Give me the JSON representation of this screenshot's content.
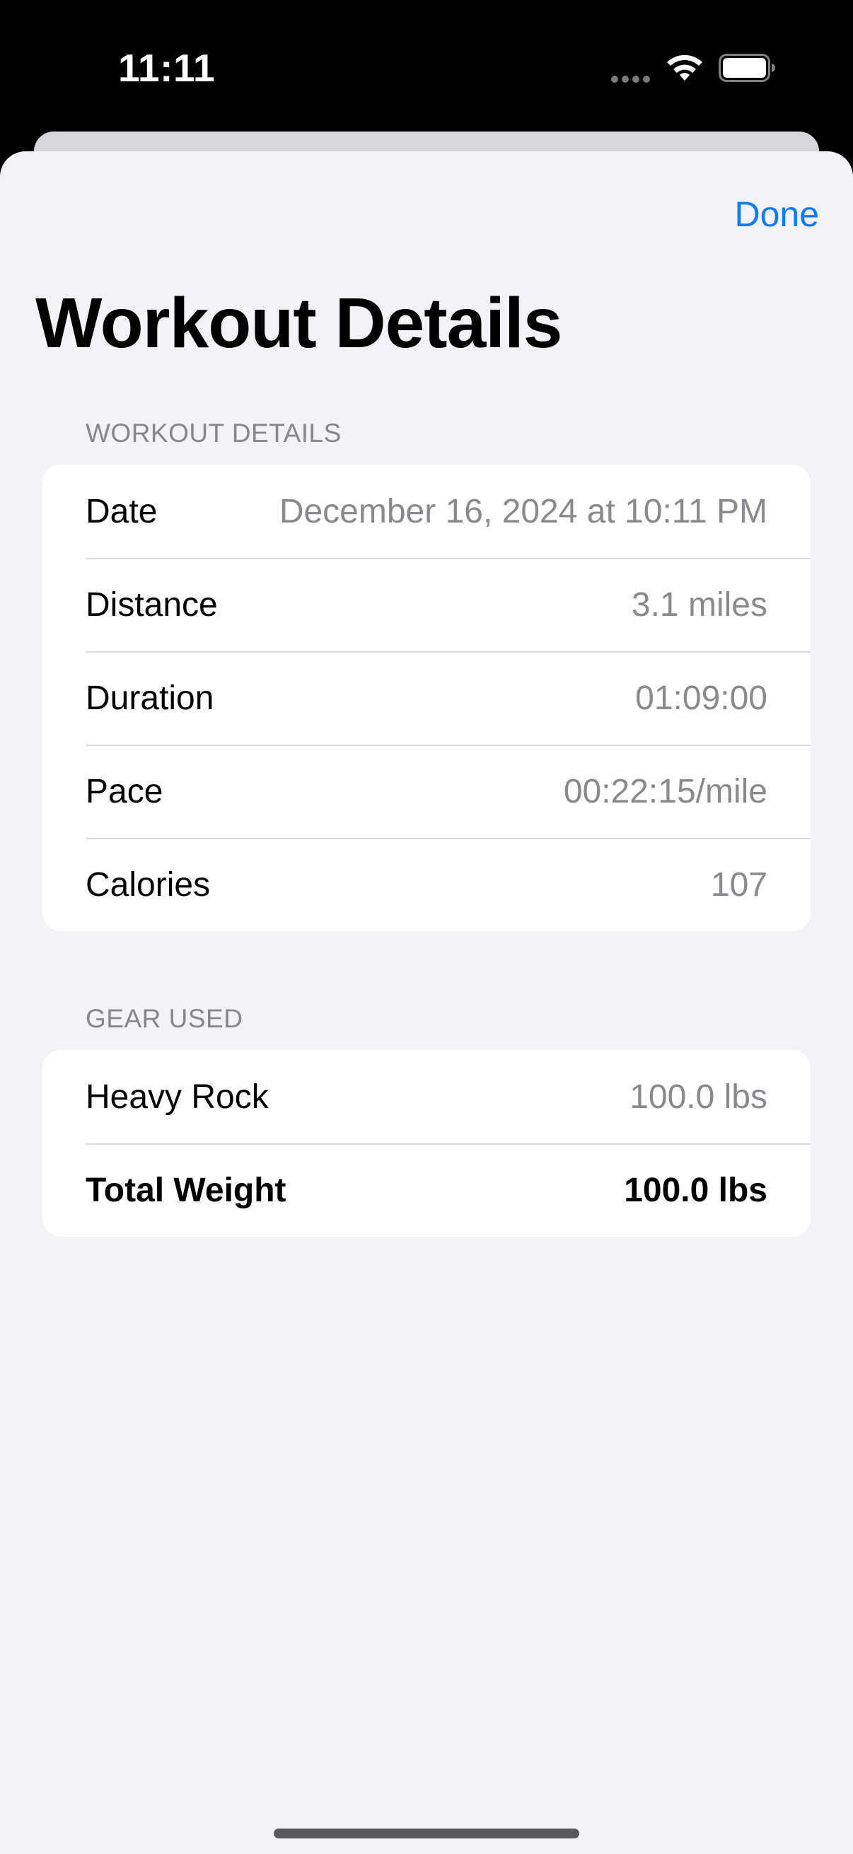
{
  "status_bar": {
    "time": "11:11",
    "wifi_icon": "wifi-icon",
    "battery_icon": "battery-icon"
  },
  "nav": {
    "done_label": "Done",
    "accent_color": "#0a7aff"
  },
  "title": "Workout Details",
  "sections": {
    "workout": {
      "header": "WORKOUT DETAILS",
      "rows": [
        {
          "label": "Date",
          "value": "December 16, 2024 at 10:11 PM"
        },
        {
          "label": "Distance",
          "value": "3.1 miles"
        },
        {
          "label": "Duration",
          "value": "01:09:00"
        },
        {
          "label": "Pace",
          "value": "00:22:15/mile"
        },
        {
          "label": "Calories",
          "value": "107"
        }
      ]
    },
    "gear": {
      "header": "GEAR USED",
      "rows": [
        {
          "label": "Heavy Rock",
          "value": "100.0 lbs"
        }
      ],
      "total": {
        "label": "Total Weight",
        "value": "100.0 lbs"
      }
    }
  }
}
